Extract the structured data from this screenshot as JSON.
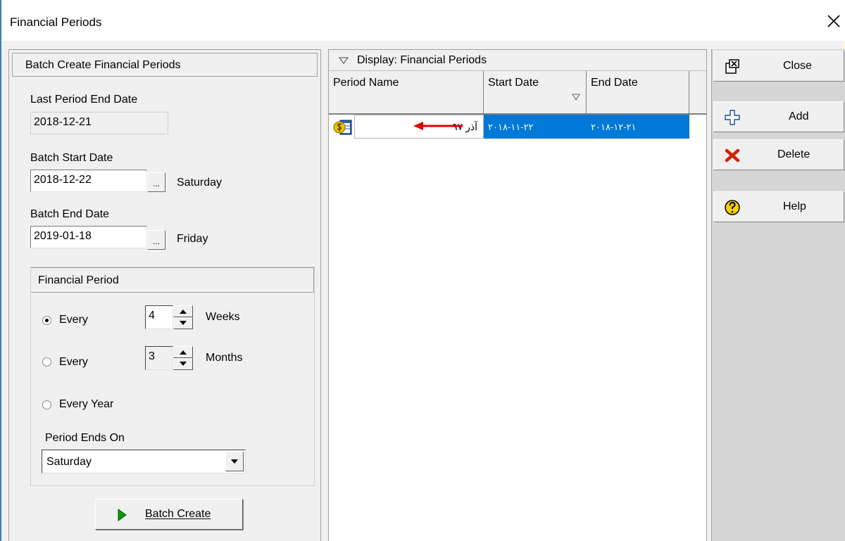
{
  "window": {
    "title": "Financial Periods"
  },
  "batch": {
    "header": "Batch Create Financial Periods",
    "last_period_label": "Last Period End Date",
    "last_period_value": "2018-12-21",
    "start_label": "Batch Start Date",
    "start_value": "2018-12-22",
    "start_day": "Saturday",
    "end_label": "Batch End Date",
    "end_value": "2019-01-18",
    "end_day": "Friday",
    "ellipsis": "..."
  },
  "financial_period": {
    "header": "Financial Period",
    "every_label": "Every",
    "weeks_value": "4",
    "weeks_label": "Weeks",
    "months_value": "3",
    "months_label": "Months",
    "every_year_label": "Every Year",
    "ends_on_label": "Period Ends On",
    "ends_on_value": "Saturday"
  },
  "batch_create_label": "Batch Create",
  "grid": {
    "display_title": "Display: Financial Periods",
    "columns": [
      "Period Name",
      "Start Date",
      "End Date"
    ],
    "rows": [
      {
        "name": "آذر ۹۷",
        "start": "۲۰۱۸-۱۱-۲۲",
        "end": "۲۰۱۸-۱۲-۲۱"
      }
    ]
  },
  "actions": {
    "close": "Close",
    "add": "Add",
    "delete": "Delete",
    "help": "Help"
  },
  "colors": {
    "selection": "#0078d7",
    "arrow": "#e00000",
    "play_green": "#00a000"
  }
}
